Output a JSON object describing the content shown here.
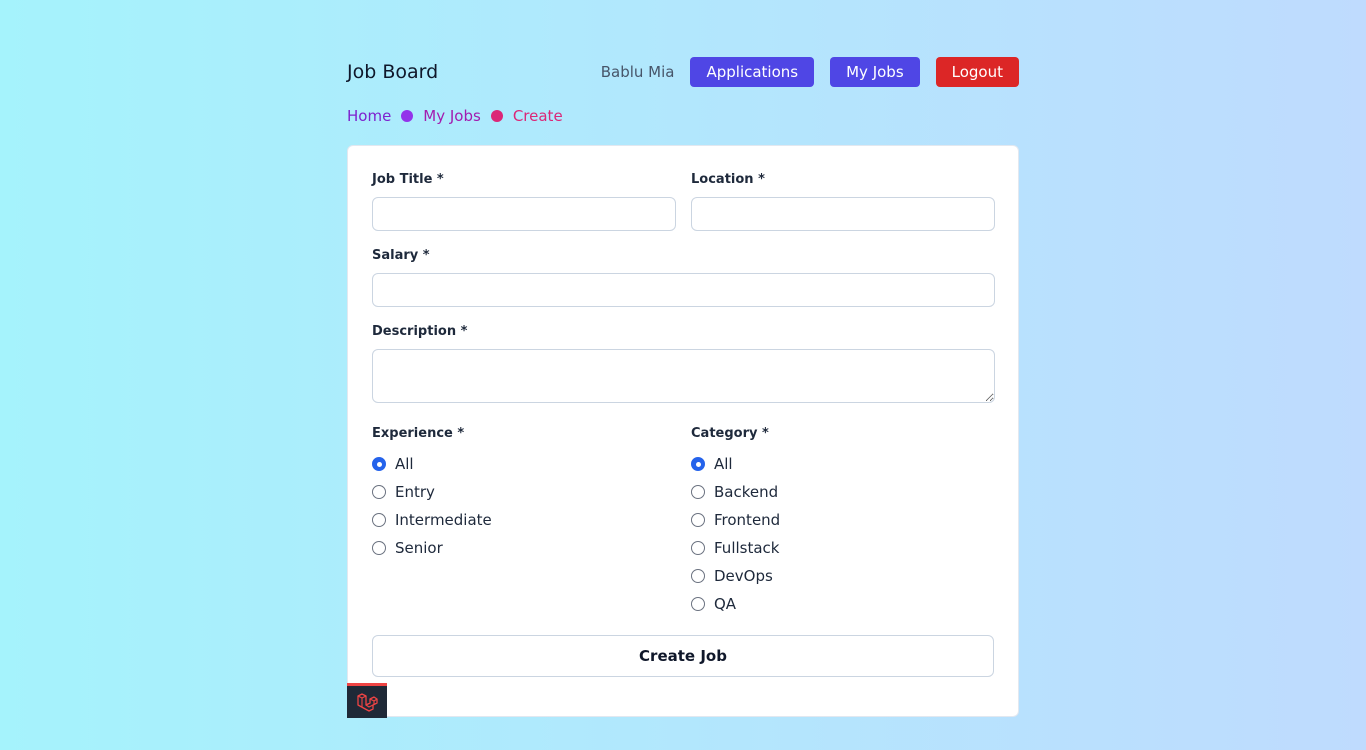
{
  "header": {
    "brand": "Job Board",
    "user_name": "Bablu Mia",
    "applications_label": "Applications",
    "my_jobs_label": "My Jobs",
    "logout_label": "Logout"
  },
  "breadcrumb": [
    "Home",
    "My Jobs",
    "Create"
  ],
  "form": {
    "title_label": "Job Title *",
    "location_label": "Location *",
    "salary_label": "Salary *",
    "description_label": "Description *",
    "experience_label": "Experience *",
    "category_label": "Category *",
    "experience_options": [
      "All",
      "Entry",
      "Intermediate",
      "Senior"
    ],
    "experience_selected": "All",
    "category_options": [
      "All",
      "Backend",
      "Frontend",
      "Fullstack",
      "DevOps",
      "QA"
    ],
    "category_selected": "All",
    "submit_label": "Create Job"
  },
  "colors": {
    "accent": "#4f46e5",
    "danger": "#dc2626",
    "radio_checked": "#2563eb"
  },
  "debugbar_icon": "laravel-logo-icon"
}
